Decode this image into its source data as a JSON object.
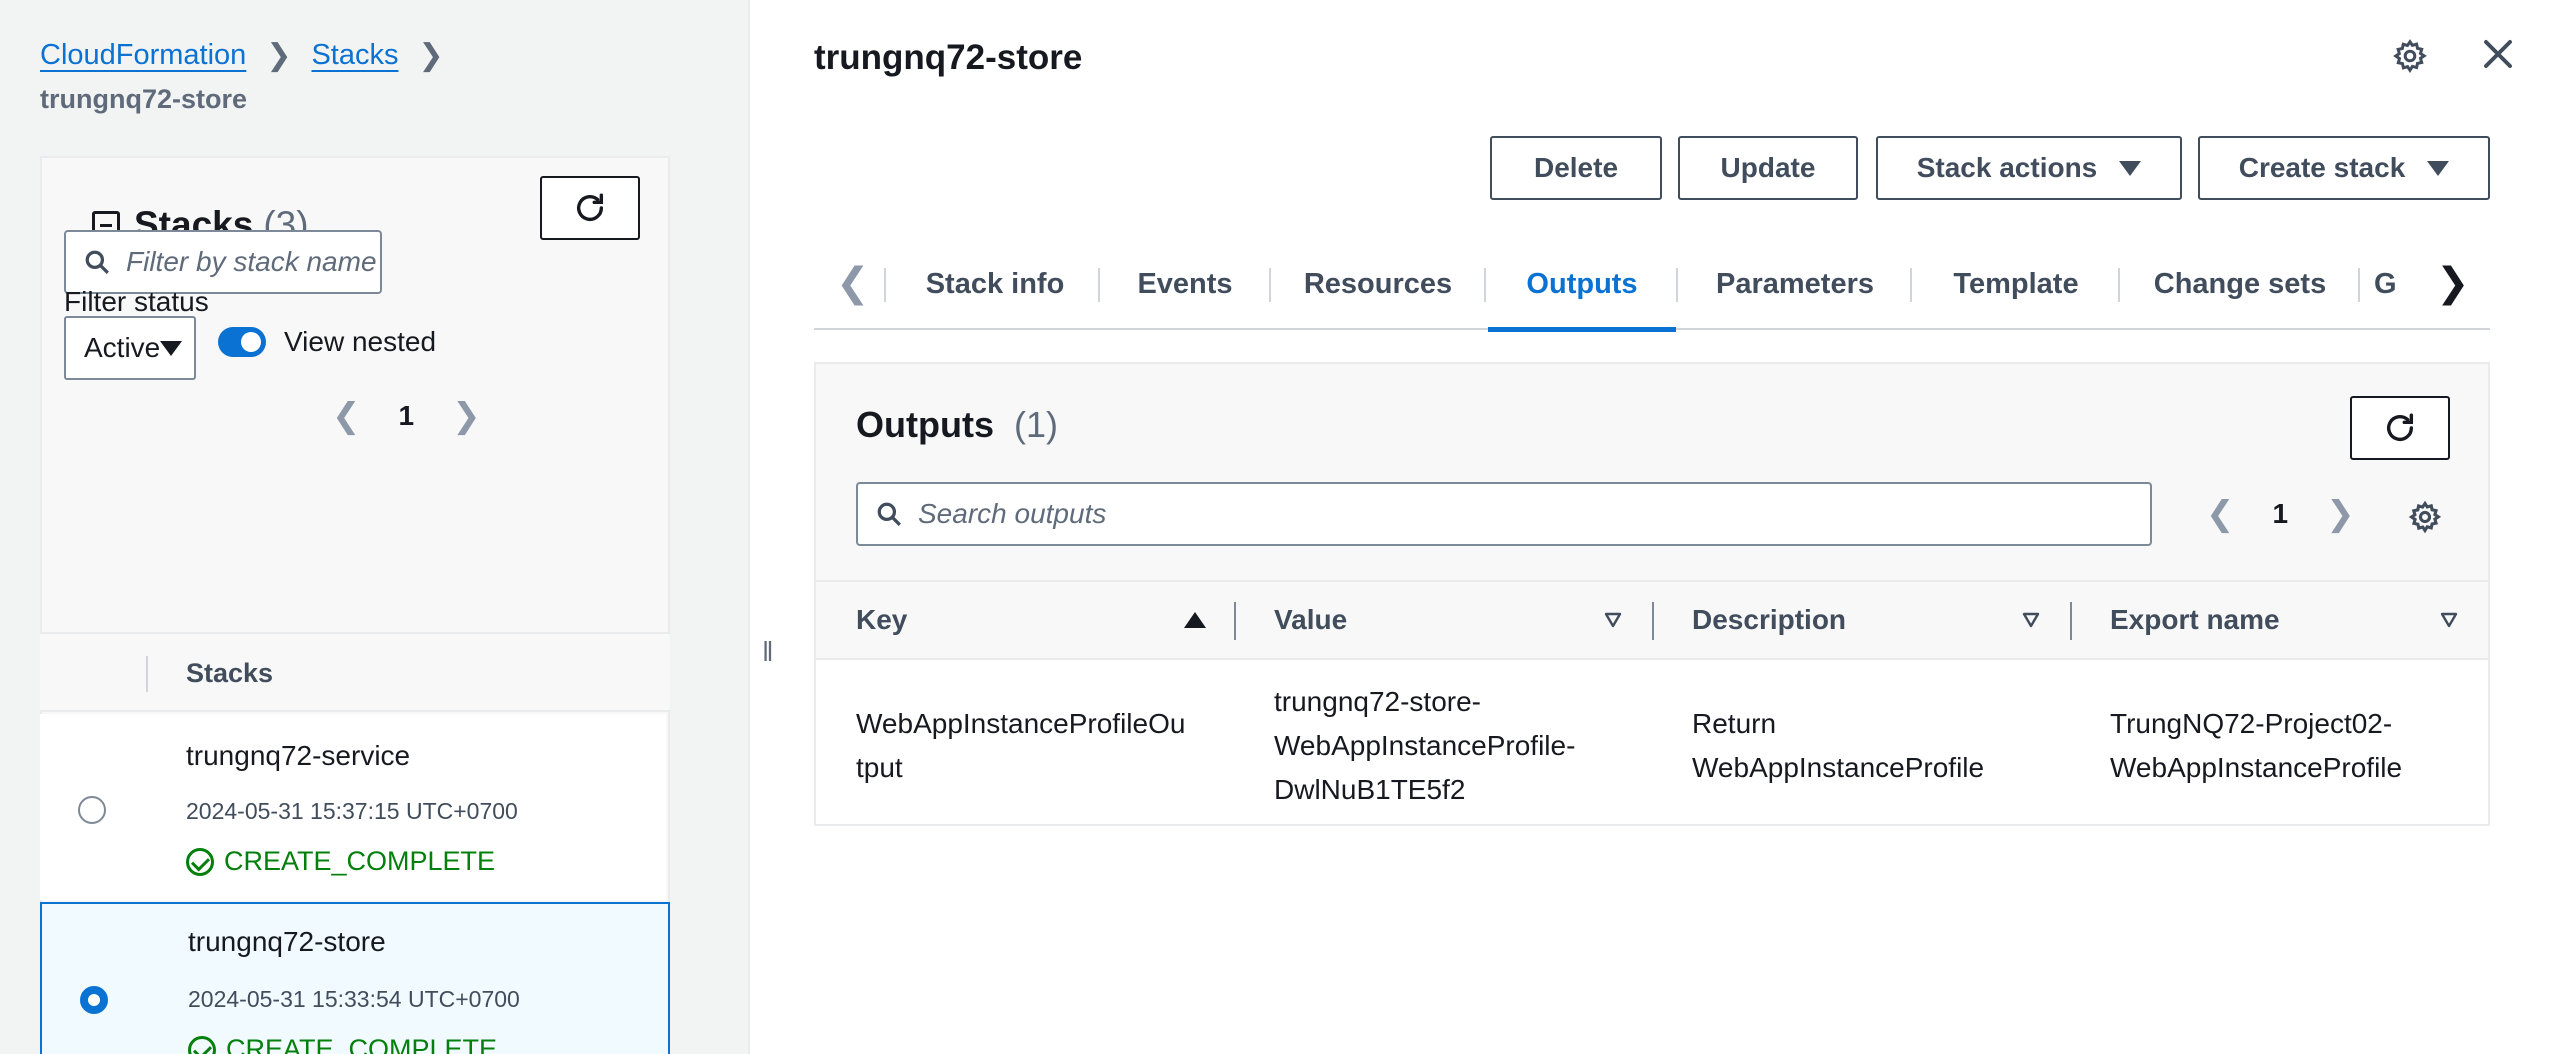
{
  "breadcrumb": {
    "items": [
      "CloudFormation",
      "Stacks"
    ],
    "current": "trungnq72-store"
  },
  "stacks_panel": {
    "title": "Stacks",
    "count": "(3)",
    "search_placeholder": "Filter by stack name",
    "filter_status_label": "Filter status",
    "filter_status_value": "Active",
    "view_nested_label": "View nested",
    "view_nested_on": true,
    "page": "1",
    "column_header": "Stacks",
    "rows": [
      {
        "name": "trungnq72-service",
        "time": "2024-05-31 15:37:15 UTC+0700",
        "status": "CREATE_COMPLETE",
        "selected": false
      },
      {
        "name": "trungnq72-store",
        "time": "2024-05-31 15:33:54 UTC+0700",
        "status": "CREATE_COMPLETE",
        "selected": true
      }
    ]
  },
  "detail": {
    "title": "trungnq72-store",
    "buttons": {
      "delete": "Delete",
      "update": "Update",
      "stack_actions": "Stack actions",
      "create_stack": "Create stack"
    },
    "tabs": [
      "Stack info",
      "Events",
      "Resources",
      "Outputs",
      "Parameters",
      "Template",
      "Change sets",
      "G"
    ],
    "active_tab": "Outputs"
  },
  "outputs": {
    "title": "Outputs",
    "count": "(1)",
    "search_placeholder": "Search outputs",
    "page": "1",
    "columns": [
      "Key",
      "Value",
      "Description",
      "Export name"
    ],
    "rows": [
      {
        "key": [
          "WebAppInstanceProfileOu",
          "tput"
        ],
        "value": [
          "trungnq72-store-",
          "WebAppInstanceProfile-",
          "DwlNuB1TE5f2"
        ],
        "description": [
          "Return",
          "WebAppInstanceProfile"
        ],
        "export_name": [
          "TrungNQ72-Project02-",
          "WebAppInstanceProfile"
        ]
      }
    ]
  },
  "colors": {
    "link": "#0972d3",
    "success": "#037f0c",
    "text": "#16191f",
    "panel_bg": "#f2f3f3"
  },
  "icons": [
    "search-icon",
    "refresh-icon",
    "settings-gear-icon",
    "close-icon",
    "chevron-left-icon",
    "chevron-right-icon",
    "caret-down-icon",
    "success-check-icon",
    "collapse-icon",
    "sort-asc-icon",
    "sort-desc-icon"
  ]
}
